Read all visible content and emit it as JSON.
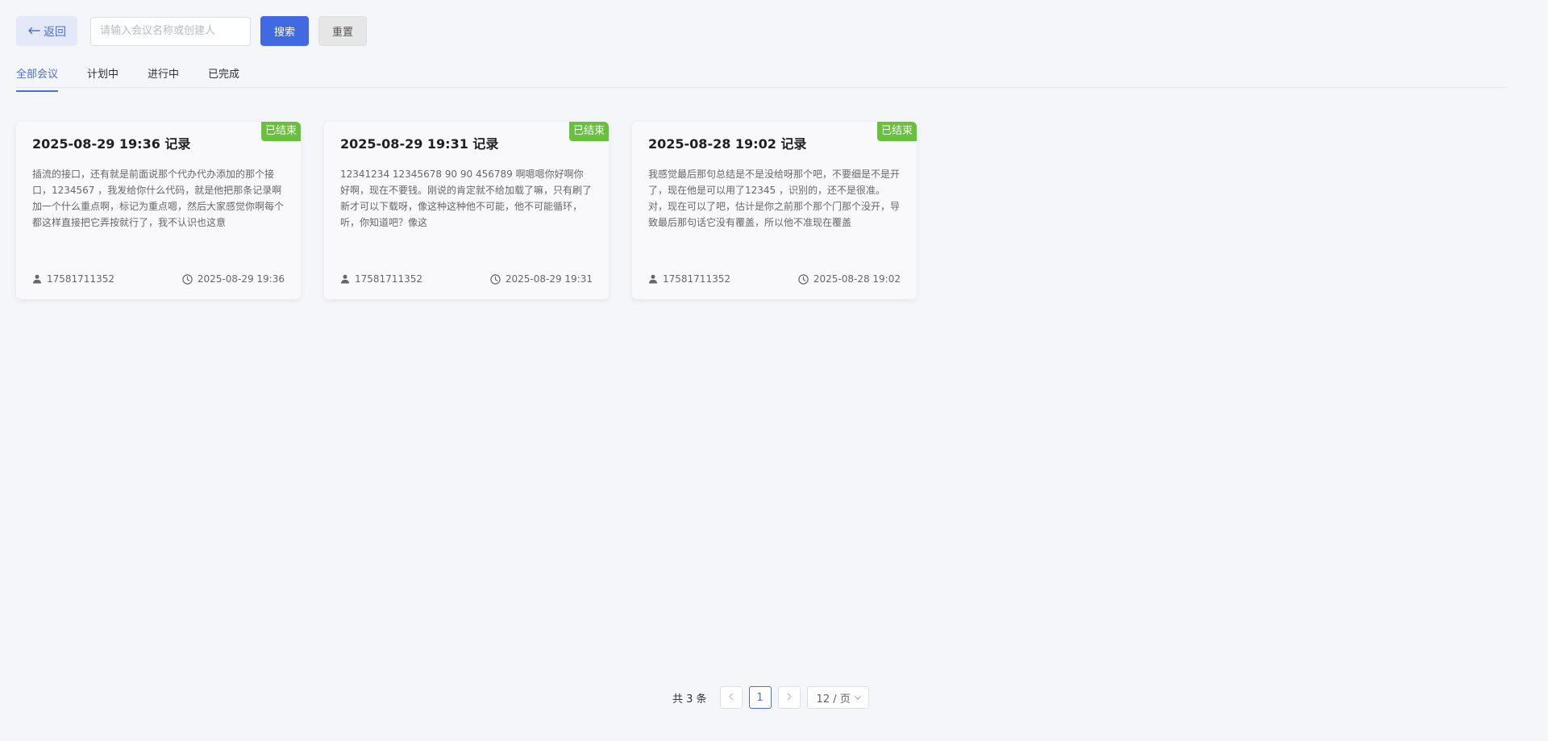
{
  "toolbar": {
    "back_label": "返回",
    "search_placeholder": "请输入会议名称或创建人",
    "search_label": "搜索",
    "reset_label": "重置"
  },
  "tabs": [
    {
      "label": "全部会议",
      "active": true
    },
    {
      "label": "计划中",
      "active": false
    },
    {
      "label": "进行中",
      "active": false
    },
    {
      "label": "已完成",
      "active": false
    }
  ],
  "cards": [
    {
      "status": "已结束",
      "title": "2025-08-29 19:36 记录",
      "summary": "插流的接口，还有就是前面说那个代办代办添加的那个接口，1234567 ，我发给你什么代码，就是他把那条记录啊加一个什么重点啊，标记为重点嗯，然后大家感觉你啊每个都这样直接把它弄按就行了，我不认识也这意",
      "creator": "17581711352",
      "time": "2025-08-29 19:36"
    },
    {
      "status": "已结束",
      "title": "2025-08-29 19:31 记录",
      "summary": "12341234 12345678 90 90 456789 啊嗯嗯你好啊你好啊，现在不要钱。刚说的肯定就不给加载了嘛，只有刷了新才可以下载呀，像这种这种他不可能，他不可能循环，听，你知道吧？像这",
      "creator": "17581711352",
      "time": "2025-08-29 19:31"
    },
    {
      "status": "已结束",
      "title": "2025-08-28 19:02 记录",
      "summary": "我感觉最后那句总结是不是没给呀那个吧，不要细是不是开了，现在他是可以用了12345 ，识别的，还不是很准。对，现在可以了吧，估计是你之前那个那个门那个没开，导致最后那句话它没有覆盖，所以他不准现在覆盖",
      "creator": "17581711352",
      "time": "2025-08-28 19:02"
    }
  ],
  "pagination": {
    "total_label": "共 3 条",
    "current_page": "1",
    "page_size_label": "12 / 页"
  },
  "colors": {
    "primary": "#4169e1",
    "accent": "#4a6fd6",
    "badge": "#67c23a",
    "background": "#f5f6fa"
  }
}
